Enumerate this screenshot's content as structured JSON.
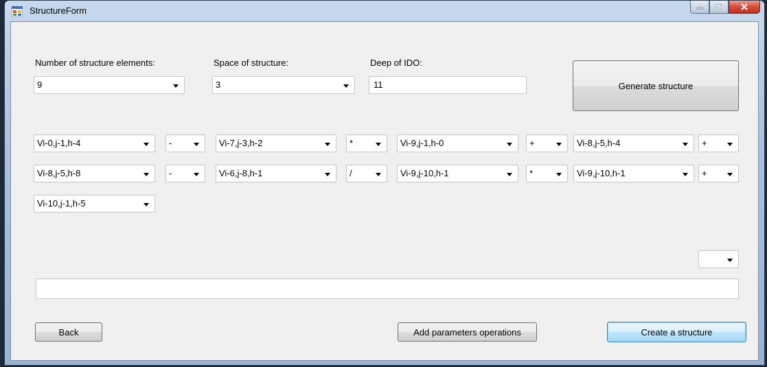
{
  "window": {
    "title": "StructureForm"
  },
  "labels": {
    "num_elements": "Number of structure elements:",
    "space": "Space of structure:",
    "deep": "Deep of IDO:"
  },
  "fields": {
    "num_elements": "9",
    "space": "3",
    "deep": "11"
  },
  "buttons": {
    "generate": "Generate structure",
    "back": "Back",
    "add_params": "Add parameters operations",
    "create": "Create a structure"
  },
  "row1": [
    "Vi-0,j-1,h-4",
    "-",
    "Vi-7,j-3,h-2",
    "*",
    "Vi-9,j-1,h-0",
    "+",
    "Vi-8,j-5,h-4",
    "+"
  ],
  "row2": [
    "Vi-8,j-5,h-8",
    "-",
    "Vi-6,j-8,h-1",
    "/",
    "Vi-9,j-10,h-1",
    "*",
    "Vi-9,j-10,h-1",
    "+"
  ],
  "row3": [
    "Vi-10,j-1,h-5"
  ],
  "small_combo": "",
  "result": ""
}
